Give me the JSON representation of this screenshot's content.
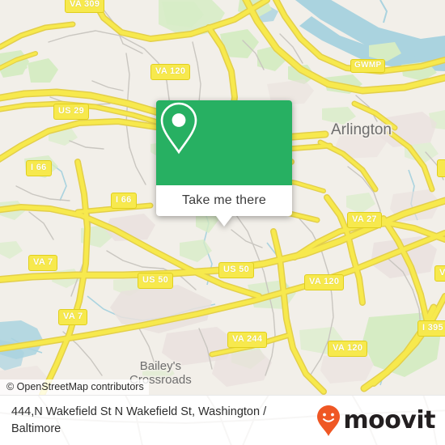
{
  "map": {
    "attribution": "© OpenStreetMap contributors",
    "background_color": "#f2efe9",
    "water_color": "#aad3df",
    "road_color": "#f7e94d",
    "park_color": "#d6ecc4",
    "places": [
      {
        "name": "Arlington",
        "label": "Arlington"
      },
      {
        "name": "baileys-crossroads",
        "line1": "Bailey's",
        "line2": "Crossroads"
      }
    ],
    "road_shields": [
      {
        "label": "VA 309"
      },
      {
        "label": "VA 120"
      },
      {
        "label": "GWMP"
      },
      {
        "label": "US 29"
      },
      {
        "label": "I 66"
      },
      {
        "label": "I 66"
      },
      {
        "label": "VA 7"
      },
      {
        "label": "VA 27"
      },
      {
        "label": "US 50"
      },
      {
        "label": "US 50"
      },
      {
        "label": "VA 120"
      },
      {
        "label": "VA 7"
      },
      {
        "label": "VA 244"
      },
      {
        "label": "VA 120"
      },
      {
        "label": "I 395"
      },
      {
        "label": "VA"
      }
    ]
  },
  "callout": {
    "color": "#27b062",
    "marker_icon": "map-pin-icon",
    "button_label": "Take me there"
  },
  "footer": {
    "title": "444,N Wakefield St N Wakefield St, Washington / Baltimore",
    "brand_name": "moovit",
    "brand_icon": "moovit-pin-icon",
    "brand_color": "#ef5724",
    "brand_text_color": "#231f20"
  }
}
